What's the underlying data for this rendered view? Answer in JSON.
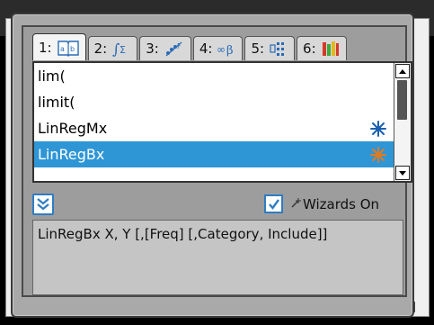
{
  "tabs": [
    {
      "label": "1:",
      "icon": "book-icon",
      "active": true
    },
    {
      "label": "2:",
      "icon": "integral-sigma-icon",
      "active": false
    },
    {
      "label": "3:",
      "icon": "probability-icon",
      "active": false
    },
    {
      "label": "4:",
      "icon": "infinity-beta-icon",
      "active": false
    },
    {
      "label": "5:",
      "icon": "matrix-icon",
      "active": false
    },
    {
      "label": "6:",
      "icon": "library-books-icon",
      "active": false
    }
  ],
  "list": {
    "items": [
      {
        "label": "lim(",
        "wizard": false,
        "selected": false
      },
      {
        "label": "limit(",
        "wizard": false,
        "selected": false
      },
      {
        "label": "LinRegMx",
        "wizard": true,
        "selected": false
      },
      {
        "label": "LinRegBx",
        "wizard": true,
        "selected": true
      }
    ]
  },
  "wizards": {
    "label": "Wizards On",
    "checked": true
  },
  "help": {
    "syntax": "LinRegBx X, Y [,[Freq] [,Category, Include]]"
  },
  "colors": {
    "selection": "#2f96d6",
    "accent": "#2f7cc3",
    "wizard_blue": "#1a5fb0",
    "wizard_orange": "#e07a1f"
  }
}
